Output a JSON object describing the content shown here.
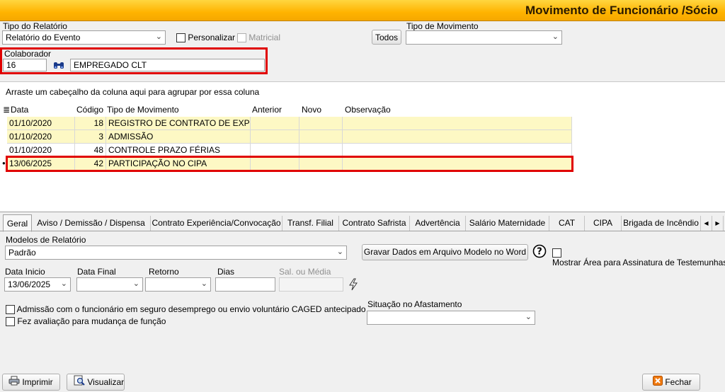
{
  "window": {
    "title": "Movimento de Funcionário /Sócio"
  },
  "header": {
    "tipo_relatorio_label": "Tipo do Relatório",
    "tipo_relatorio_value": "Relatório do Evento",
    "personalizar_label": "Personalizar",
    "matricial_label": "Matricial",
    "todos_label": "Todos",
    "tipo_movimento_label": "Tipo de Movimento",
    "tipo_movimento_value": ""
  },
  "colaborador": {
    "label": "Colaborador",
    "code": "16",
    "name": "EMPREGADO CLT"
  },
  "grid": {
    "group_hint": "Arraste um cabeçalho da coluna aqui para agrupar por essa coluna",
    "columns": [
      "Data",
      "Código",
      "Tipo de Movimento",
      "Anterior",
      "Novo",
      "Observação"
    ],
    "rows": [
      {
        "data": "01/10/2020",
        "codigo": "18",
        "tipo": "REGISTRO DE CONTRATO DE EXPERII",
        "anterior": "",
        "novo": "",
        "obs": ""
      },
      {
        "data": "01/10/2020",
        "codigo": "3",
        "tipo": "ADMISSÃO",
        "anterior": "",
        "novo": "",
        "obs": ""
      },
      {
        "data": "01/10/2020",
        "codigo": "48",
        "tipo": "CONTROLE PRAZO FÉRIAS",
        "anterior": "",
        "novo": "",
        "obs": ""
      },
      {
        "data": "13/06/2025",
        "codigo": "42",
        "tipo": "PARTICIPAÇÃO NO CIPA",
        "anterior": "",
        "novo": "",
        "obs": ""
      }
    ]
  },
  "tabs": [
    "Geral",
    "Aviso / Demissão / Dispensa",
    "Contrato Experiência/Convocação",
    "Transf. Filial",
    "Contrato Safrista",
    "Advertência",
    "Salário Maternidade",
    "CAT",
    "CIPA",
    "Brigada de Incêndio"
  ],
  "geral": {
    "modelos_label": "Modelos de Relatório",
    "modelos_value": "Padrão",
    "gravar_label": "Gravar Dados em Arquivo Modelo no Word",
    "mostrar_label": "Mostrar Área para Assinatura de Testemunhas",
    "data_inicio_label": "Data Inicio",
    "data_inicio_value": "13/06/2025",
    "data_final_label": "Data Final",
    "retorno_label": "Retorno",
    "dias_label": "Dias",
    "sal_media_label": "Sal. ou Média",
    "admissao_label": "Admissão com o funcionário em seguro desemprego ou envio voluntário CAGED antecipado",
    "avaliacao_label": "Fez avaliação para mudança de função",
    "situacao_label": "Situação no Afastamento"
  },
  "footer": {
    "imprimir_label": "Imprimir",
    "visualizar_label": "Visualizar",
    "fechar_label": "Fechar"
  },
  "colors": {
    "title_bar": "#ffb300",
    "row_yellow": "#fdf8c4",
    "highlight_red": "#e00000"
  }
}
